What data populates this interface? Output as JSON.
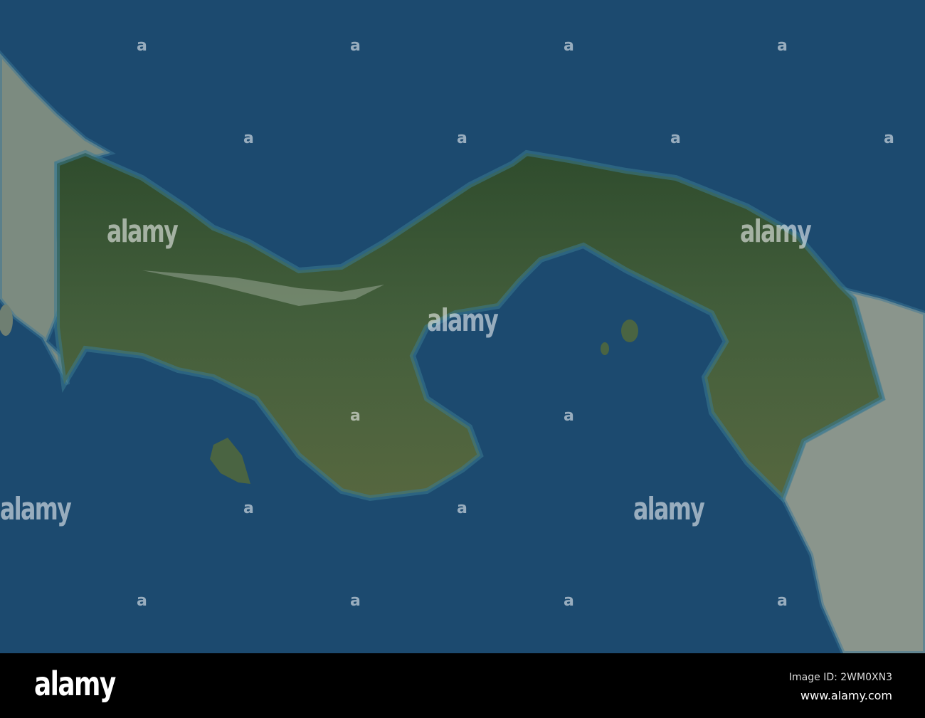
{
  "map": {
    "colors": {
      "ocean": "#1c4a6f",
      "land": "#3e5c3a",
      "neighbor": "#7c8b80",
      "coast": "#2d6b8a"
    }
  },
  "watermarks": {
    "text": "alamy",
    "mark": "a"
  },
  "footer": {
    "logo": "alamy",
    "image_id": "Image ID: 2WM0XN3",
    "url": "www.alamy.com"
  }
}
